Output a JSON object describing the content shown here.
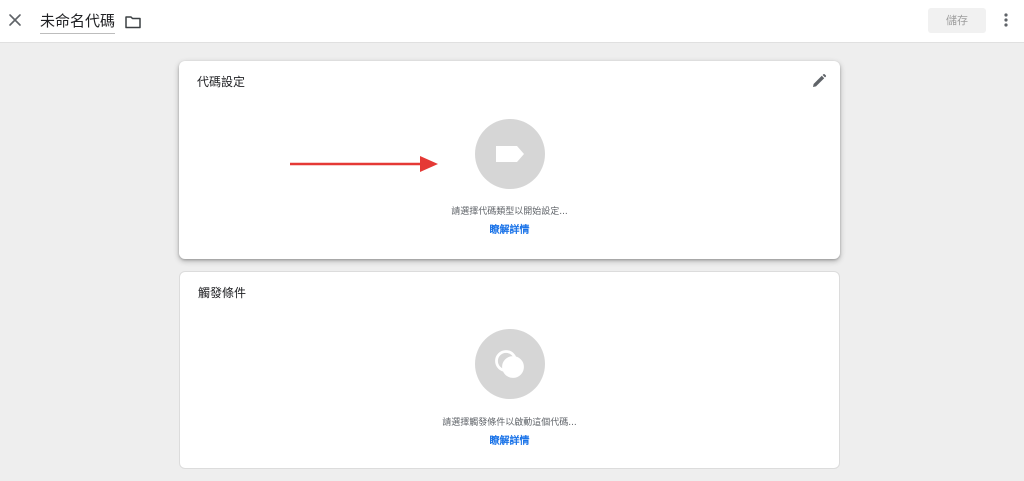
{
  "header": {
    "title": "未命名代碼",
    "save_label": "儲存"
  },
  "tag_config": {
    "title": "代碼設定",
    "hint": "請選擇代碼類型以開始設定...",
    "learn_more": "瞭解詳情"
  },
  "triggering": {
    "title": "觸發條件",
    "hint": "請選擇觸發條件以啟動這個代碼...",
    "learn_more": "瞭解詳情"
  },
  "colors": {
    "accent_link": "#1a73e8",
    "arrow_annotation": "#e53935",
    "icon_circle": "#d6d6d6"
  },
  "icons": [
    "close-icon",
    "folder-icon",
    "more-vert-icon",
    "pencil-icon",
    "tag-icon",
    "trigger-circles-icon",
    "red-arrow-annotation"
  ]
}
